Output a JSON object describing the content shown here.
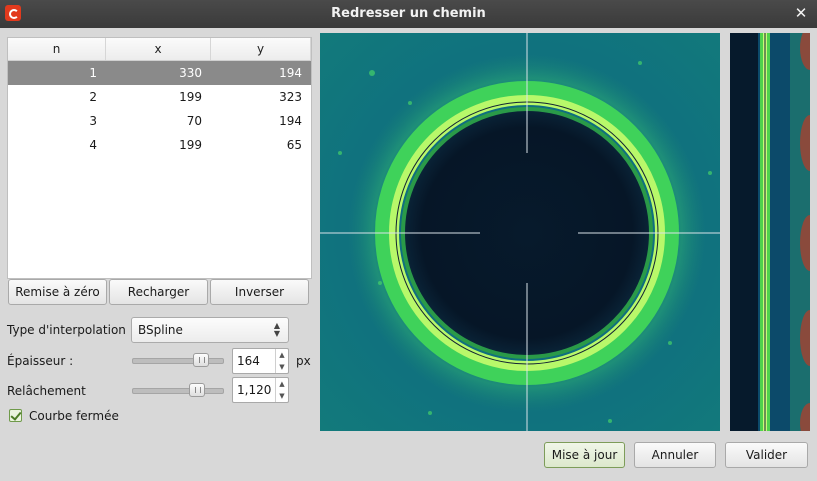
{
  "window": {
    "title": "Redresser un chemin",
    "icon": "gimp-app-icon",
    "close_icon": "close-icon"
  },
  "table": {
    "headers": [
      "n",
      "x",
      "y"
    ],
    "rows": [
      {
        "n": "1",
        "x": "330",
        "y": "194",
        "selected": true
      },
      {
        "n": "2",
        "x": "199",
        "y": "323",
        "selected": false
      },
      {
        "n": "3",
        "x": "70",
        "y": "194",
        "selected": false
      },
      {
        "n": "4",
        "x": "199",
        "y": "65",
        "selected": false
      }
    ]
  },
  "buttons": {
    "reset": "Remise à zéro",
    "reload": "Recharger",
    "invert": "Inverser"
  },
  "interpolation": {
    "label": "Type d'interpolation :",
    "value": "BSpline"
  },
  "thickness": {
    "label": "Épaisseur :",
    "value": "164",
    "unit": "px",
    "level": 0.8
  },
  "relaxation": {
    "label": "Relâchement",
    "value": "1,120",
    "level": 0.75
  },
  "closed_curve": {
    "label": "Courbe fermée",
    "checked": true
  },
  "footer": {
    "update": "Mise à jour",
    "cancel": "Annuler",
    "validate": "Valider"
  },
  "colors": {
    "selection": "#8a8a8a",
    "ring": "#6ee83a",
    "image_bg": "#0f5a73",
    "center": "#06182a",
    "strip_spot": "#8a4a3c"
  }
}
